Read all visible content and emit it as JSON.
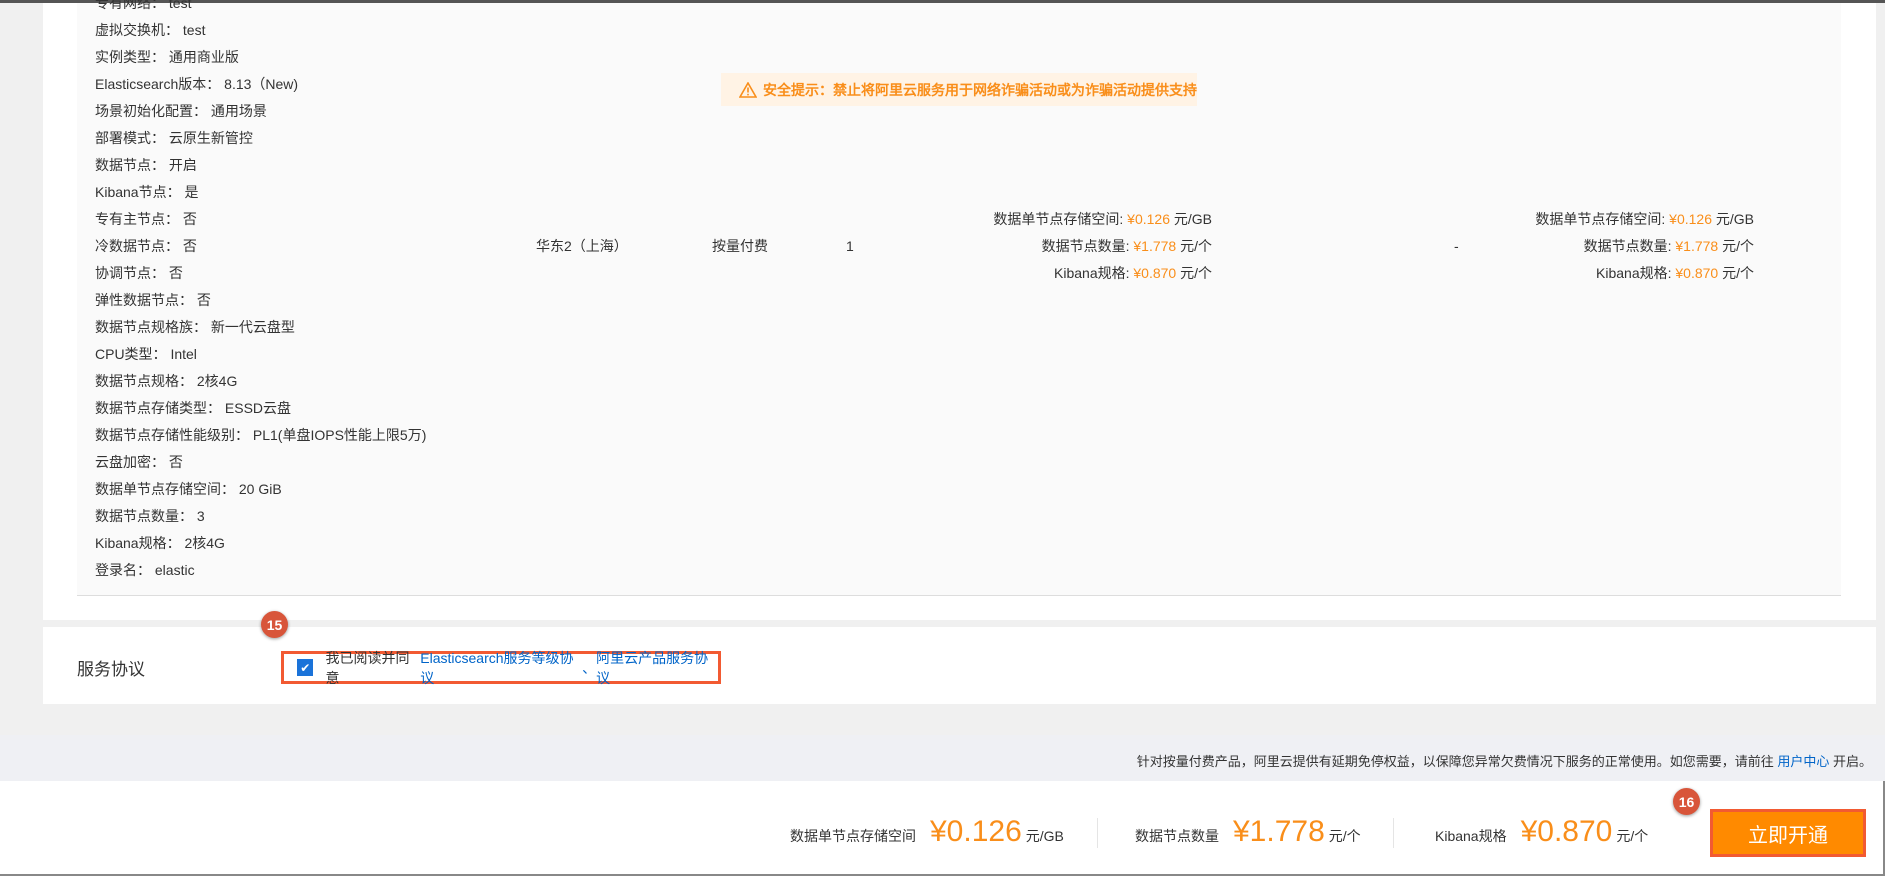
{
  "config_rows": [
    {
      "label": "专有网络：",
      "value": "test"
    },
    {
      "label": "虚拟交换机：",
      "value": "test"
    },
    {
      "label": "实例类型：",
      "value": "通用商业版"
    },
    {
      "label": "Elasticsearch版本：",
      "value": "8.13（New)"
    },
    {
      "label": "场景初始化配置：",
      "value": "通用场景"
    },
    {
      "label": "部署模式：",
      "value": "云原生新管控"
    },
    {
      "label": "数据节点：",
      "value": "开启"
    },
    {
      "label": "Kibana节点：",
      "value": "是"
    },
    {
      "label": "专有主节点：",
      "value": "否"
    },
    {
      "label": "冷数据节点：",
      "value": "否"
    },
    {
      "label": "协调节点：",
      "value": "否"
    },
    {
      "label": "弹性数据节点：",
      "value": "否"
    },
    {
      "label": "数据节点规格族：",
      "value": "新一代云盘型"
    },
    {
      "label": "CPU类型：",
      "value": "Intel"
    },
    {
      "label": "数据节点规格：",
      "value": "2核4G"
    },
    {
      "label": "数据节点存储类型：",
      "value": "ESSD云盘"
    },
    {
      "label": "数据节点存储性能级别：",
      "value": "PL1(单盘IOPS性能上限5万)"
    },
    {
      "label": "云盘加密：",
      "value": "否"
    },
    {
      "label": "数据单节点存储空间：",
      "value": "20 GiB"
    },
    {
      "label": "数据节点数量：",
      "value": "3"
    },
    {
      "label": "Kibana规格：",
      "value": "2核4G"
    },
    {
      "label": "登录名：",
      "value": "elastic"
    }
  ],
  "order": {
    "region": "华东2（上海）",
    "billing": "按量付费",
    "quantity": "1",
    "discount": "-"
  },
  "prices": [
    {
      "label": "数据单节点存储空间:",
      "price": "¥0.126",
      "unit": "元/GB"
    },
    {
      "label": "数据节点数量:",
      "price": "¥1.778",
      "unit": "元/个"
    },
    {
      "label": "Kibana规格:",
      "price": "¥0.870",
      "unit": "元/个"
    }
  ],
  "warning": "安全提示：禁止将阿里云服务用于网络诈骗活动或为诈骗活动提供支持",
  "service": {
    "title": "服务协议",
    "agree_text": "我已阅读并同意",
    "link1": "Elasticsearch服务等级协议",
    "sep": "、",
    "link2": "阿里云产品服务协议",
    "badge": "15"
  },
  "notice": {
    "text": "针对按量付费产品，阿里云提供有延期免停权益，以保障您异常欠费情况下服务的正常使用。如您需要，请前往 ",
    "link": "用户中心",
    "tail": " 开启。"
  },
  "footer": {
    "items": [
      {
        "label": "数据单节点存储空间",
        "price": "¥0.126",
        "unit": "元/GB"
      },
      {
        "label": "数据节点数量",
        "price": "¥1.778",
        "unit": "元/个"
      },
      {
        "label": "Kibana规格",
        "price": "¥0.870",
        "unit": "元/个"
      }
    ],
    "buy_label": "立即开通",
    "badge": "16"
  },
  "colors": {
    "accent": "#ff8a00",
    "price": "#f98e1a",
    "link": "#0064c8",
    "highlight": "#f25a32"
  }
}
